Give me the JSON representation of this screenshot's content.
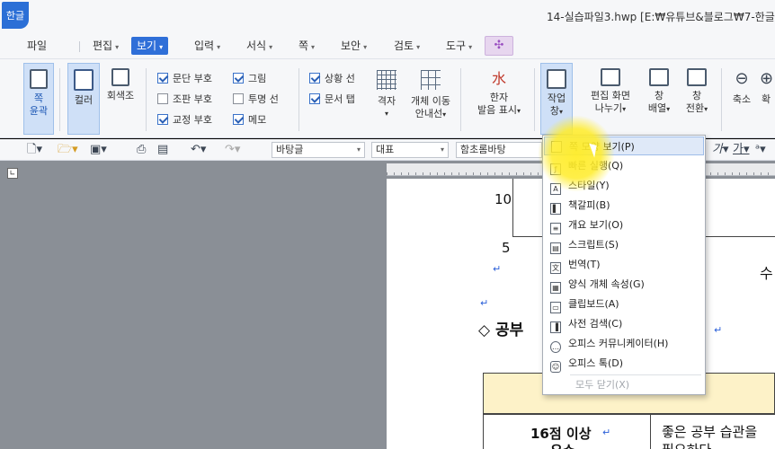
{
  "window": {
    "app_logo": "한글",
    "title": "14-실습파일3.hwp [E:₩유튜브&블로그₩7-한글"
  },
  "menubar": {
    "items": [
      "파일",
      "편집",
      "보기",
      "입력",
      "서식",
      "쪽",
      "보안",
      "검토",
      "도구"
    ],
    "active": "보기",
    "extension_icon": "puzzle-icon"
  },
  "ribbon": {
    "page_outline": "쪽\n윤곽",
    "color": "컬러",
    "grayscale": "회색조",
    "checkboxes_col1": [
      {
        "label": "문단 부호",
        "checked": true
      },
      {
        "label": "조판 부호",
        "checked": false
      },
      {
        "label": "교정 부호",
        "checked": true
      }
    ],
    "checkboxes_col2": [
      {
        "label": "그림",
        "checked": true
      },
      {
        "label": "투명 선",
        "checked": false
      },
      {
        "label": "메모",
        "checked": true
      }
    ],
    "checkboxes_col3": [
      {
        "label": "상황 선",
        "checked": true
      },
      {
        "label": "문서 탭",
        "checked": true
      }
    ],
    "grid": "격자",
    "object_move_guide_1": "개체 이동",
    "object_move_guide_2": "안내선",
    "hanja_1": "한자",
    "hanja_2": "발음 표시",
    "task_window_1": "작업",
    "task_window_2": "창",
    "edit_screen_split_1": "편집 화면",
    "edit_screen_split_2": "나누기",
    "window_arrange_1": "창",
    "window_arrange_2": "배열",
    "window_switch_1": "창",
    "window_switch_2": "전환",
    "zoom_out": "축소",
    "zoom_in": "확"
  },
  "toolbar": {
    "style_combo": "바탕글",
    "rep_combo": "대표",
    "font_combo": "함초롬바탕",
    "italic": "가",
    "underline": "가"
  },
  "document": {
    "axis_10": "10",
    "axis_5": "5",
    "su_text": "수",
    "heading": "◇ 공부",
    "row1_left_1": "16점 이상",
    "row1_left_2": "우수",
    "row1_right_1": "좋은 공부 습관을",
    "row1_right_2": "필요하다."
  },
  "dropdown": {
    "items": [
      {
        "label": "쪽 모양 보기(P)",
        "highlighted": true
      },
      {
        "label": "빠른 실행(Q)"
      },
      {
        "label": "스타일(Y)"
      },
      {
        "label": "책갈피(B)"
      },
      {
        "label": "개요 보기(O)"
      },
      {
        "label": "스크립트(S)"
      },
      {
        "label": "번역(T)"
      },
      {
        "label": "양식 개체 속성(G)"
      },
      {
        "label": "클립보드(A)"
      },
      {
        "label": "사전 검색(C)"
      },
      {
        "label": "오피스 커뮤니케이터(H)"
      },
      {
        "label": "오피스 톡(D)"
      },
      {
        "label": "모두 닫기(X)",
        "disabled": true
      }
    ]
  }
}
